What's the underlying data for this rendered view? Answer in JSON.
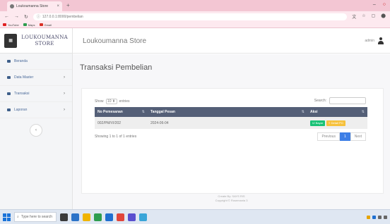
{
  "browser": {
    "tab_title": "Loukoumanna Store",
    "url": "127.0.0.1:8000/pembelian",
    "bookmarks": [
      "YouTube",
      "Maps",
      "Gmail"
    ]
  },
  "brand": {
    "line1": "LOUKOUMANNA",
    "line2": "STORE"
  },
  "sidebar": {
    "items": [
      {
        "label": "Beranda",
        "icon": "home-icon"
      },
      {
        "label": "Data Master",
        "icon": "database-icon"
      },
      {
        "label": "Transaksi",
        "icon": "exchange-icon"
      },
      {
        "label": "Laporan",
        "icon": "report-icon"
      }
    ]
  },
  "topbar": {
    "app_title": "Loukoumanna Store",
    "user": "admin"
  },
  "page": {
    "title": "Transaksi Pembelian"
  },
  "table": {
    "show_label": "Show",
    "entries_value": "10",
    "entries_label": "entries",
    "search_label": "Search:",
    "columns": [
      "No Pemesanan",
      "Tanggal Pesan",
      "Aksi"
    ],
    "rows": [
      {
        "no": "002/PM/VI/202",
        "tanggal": "2024-06-04",
        "actions": [
          "Bayar",
          "Detail PO"
        ]
      }
    ],
    "info": "Showing 1 to 1 of 1 entries",
    "pagination": {
      "prev": "Previous",
      "page": "1",
      "next": "Next"
    }
  },
  "footer": {
    "line1": "Create By: SAYS RIS",
    "line2": "Copyright © Rosemania 3"
  },
  "taskbar": {
    "search_placeholder": "Type here to search"
  },
  "colors": {
    "header": "#545f77",
    "green": "#19c276",
    "yellow": "#f6c13c",
    "primary": "#3d7ee6"
  }
}
